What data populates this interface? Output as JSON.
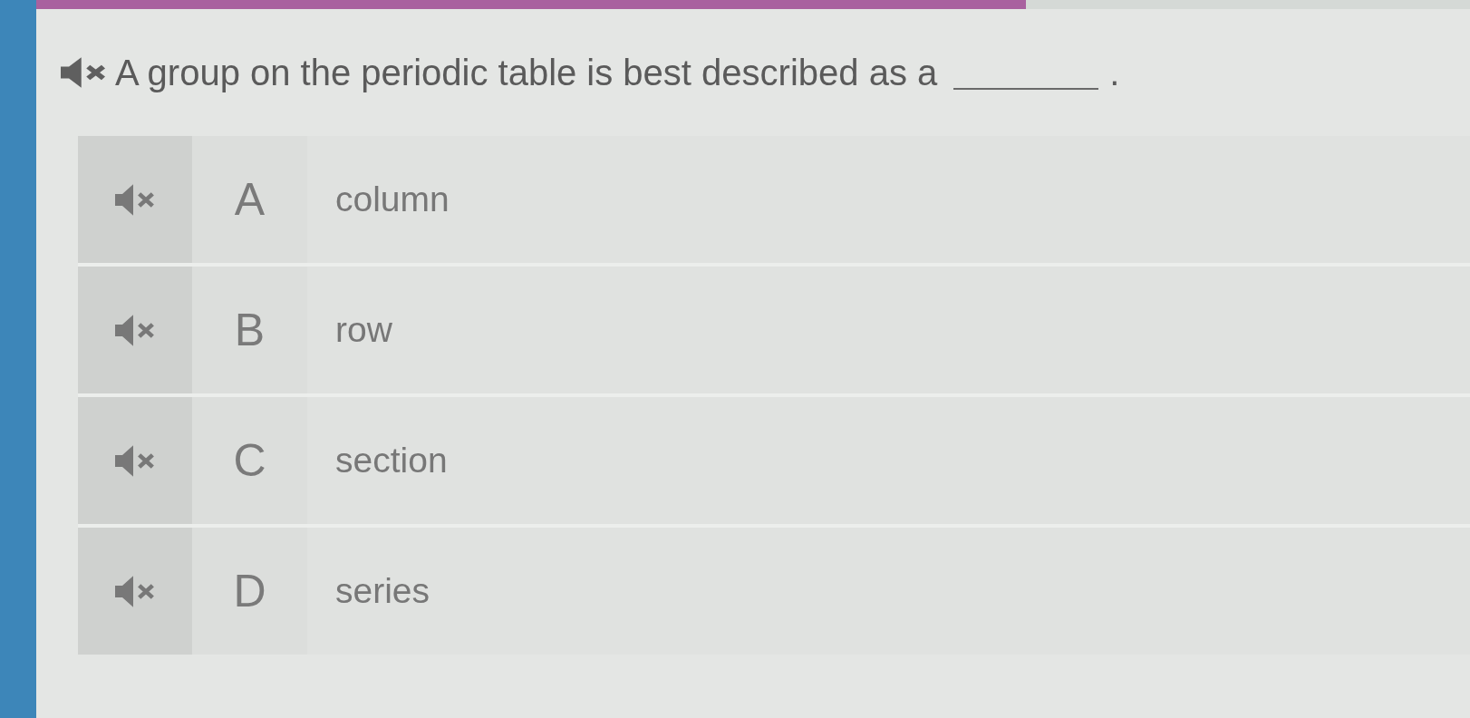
{
  "progress": {
    "level": 0.69
  },
  "question": {
    "text": "A group on the periodic table is best described as a",
    "after_blank": "."
  },
  "answers": [
    {
      "letter": "A",
      "text": "column",
      "selected": false
    },
    {
      "letter": "B",
      "text": "row",
      "selected": false
    },
    {
      "letter": "C",
      "text": "section",
      "selected": false
    },
    {
      "letter": "D",
      "text": "series",
      "selected": false
    }
  ]
}
